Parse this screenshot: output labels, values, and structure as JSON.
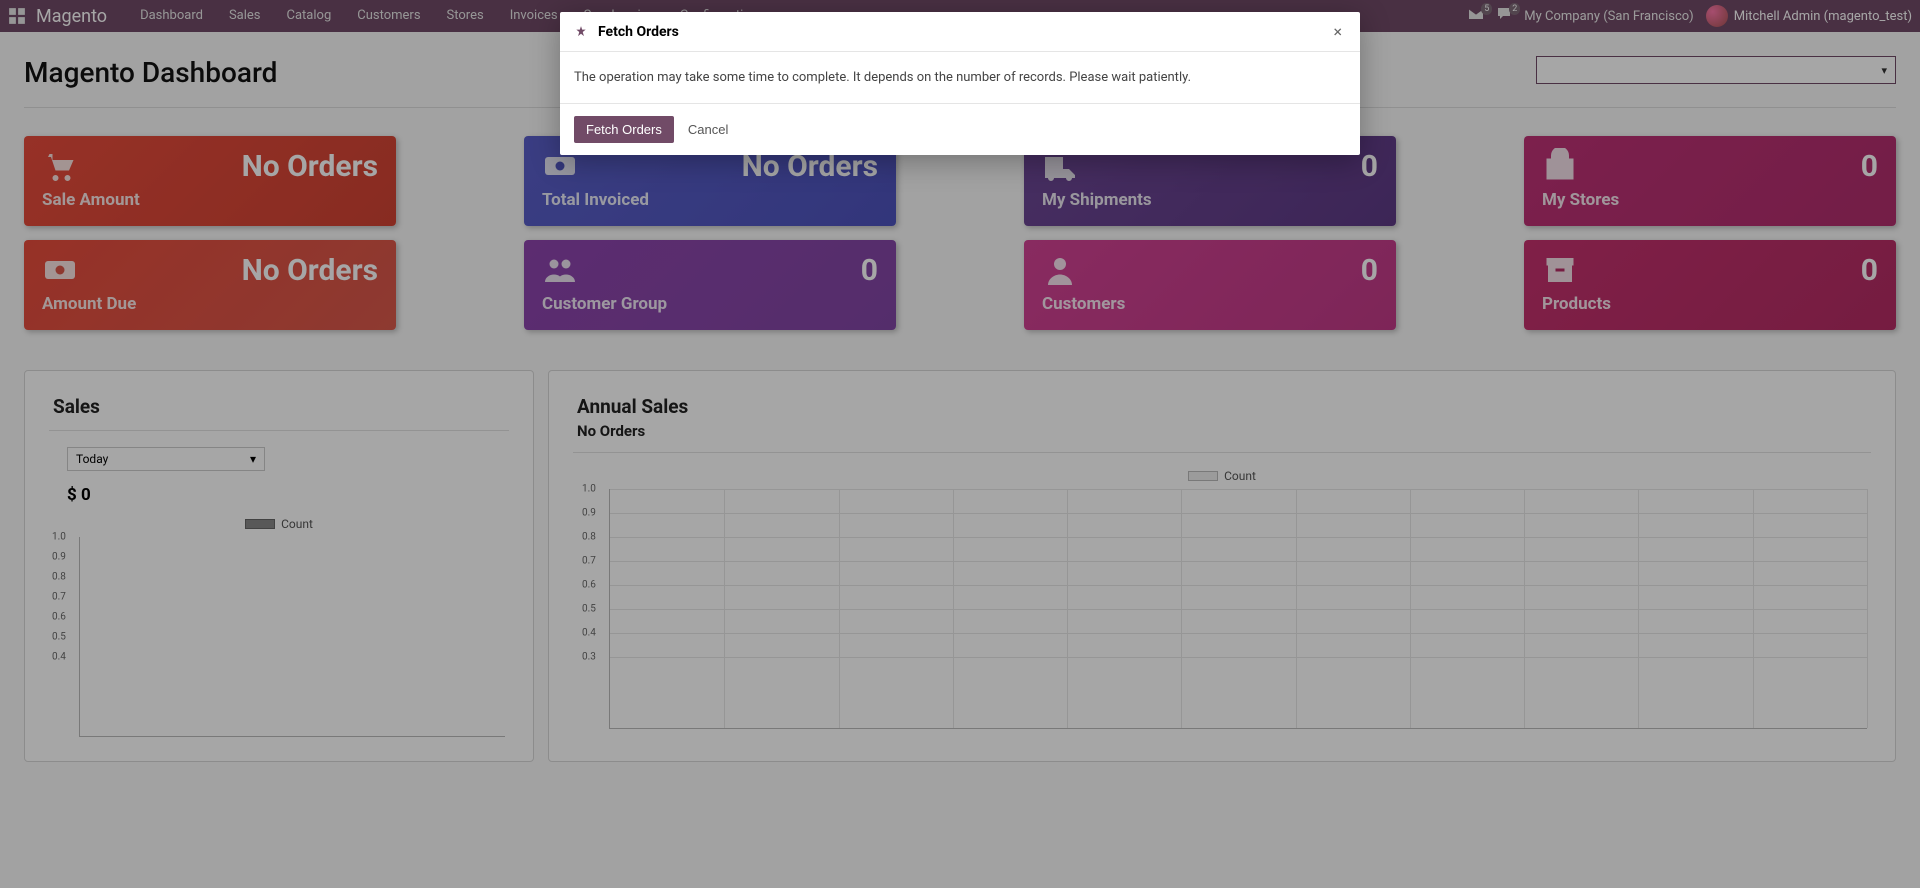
{
  "topnav": {
    "brand": "Magento",
    "menu": [
      "Dashboard",
      "Sales",
      "Catalog",
      "Customers",
      "Stores",
      "Invoices",
      "Synchronize",
      "Configuration"
    ],
    "mail_badge": "5",
    "chat_badge": "2",
    "company": "My Company (San Francisco)",
    "user": "Mitchell Admin (magento_test)"
  },
  "page": {
    "title": "Magento Dashboard"
  },
  "stats": {
    "sale_amount": {
      "val": "No Orders",
      "lbl": "Sale Amount"
    },
    "amount_due": {
      "val": "No Orders",
      "lbl": "Amount Due"
    },
    "total_invoiced": {
      "val": "No Orders",
      "lbl": "Total Invoiced"
    },
    "customer_group": {
      "val": "0",
      "lbl": "Customer Group"
    },
    "my_shipments": {
      "val": "0",
      "lbl": "My Shipments"
    },
    "customers": {
      "val": "0",
      "lbl": "Customers"
    },
    "my_stores": {
      "val": "0",
      "lbl": "My Stores"
    },
    "products": {
      "val": "0",
      "lbl": "Products"
    }
  },
  "sales_panel": {
    "title": "Sales",
    "period": "Today",
    "amount": "$ 0",
    "legend": "Count"
  },
  "annual_panel": {
    "title": "Annual Sales",
    "subtitle": "No Orders",
    "legend": "Count"
  },
  "chart_data": [
    {
      "type": "bar",
      "panel": "sales",
      "title": "Sales",
      "amount_label": "$ 0",
      "legend": "Count",
      "categories": [],
      "values": [],
      "ylim": [
        0,
        1
      ],
      "yticks": [
        1.0,
        0.9,
        0.8,
        0.7,
        0.6,
        0.5,
        0.4
      ]
    },
    {
      "type": "bar",
      "panel": "annual",
      "title": "Annual Sales",
      "subtitle": "No Orders",
      "legend": "Count",
      "categories": [],
      "values": [],
      "ylim": [
        0,
        1
      ],
      "yticks": [
        1.0,
        0.9,
        0.8,
        0.7,
        0.6,
        0.5,
        0.4,
        0.3
      ]
    }
  ],
  "modal": {
    "title": "Fetch Orders",
    "body": "The operation may take some time to complete. It depends on the number of records. Please wait patiently.",
    "primary": "Fetch Orders",
    "cancel": "Cancel",
    "close": "×"
  }
}
